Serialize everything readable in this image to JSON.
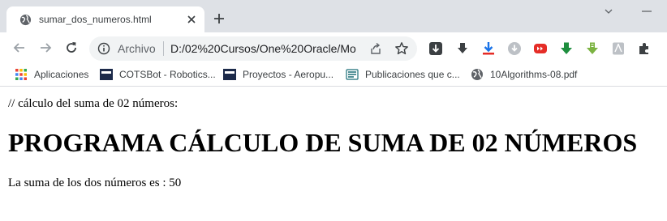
{
  "tab": {
    "title": "sumar_dos_numeros.html"
  },
  "omnibox": {
    "scheme_label": "Archivo",
    "url": "D:/02%20Cursos/One%20Oracle/Mo..."
  },
  "bookmarks": [
    {
      "label": "Aplicaciones",
      "icon": "apps-grid-icon"
    },
    {
      "label": "COTSBot - Robotics...",
      "icon": "qut-icon"
    },
    {
      "label": "Proyectos - Aeropu...",
      "icon": "qut-icon"
    },
    {
      "label": "Publicaciones que c...",
      "icon": "publications-icon"
    },
    {
      "label": "10Algorithms-08.pdf",
      "icon": "globe-icon"
    }
  ],
  "page": {
    "comment": "// cálculo del suma de 02 números:",
    "heading": "PROGRAMA CÁLCULO DE SUMA DE 02 NÚMEROS",
    "result": "La suma de los dos números es : 50"
  },
  "colors": {
    "tabstrip": "#dee1e6",
    "omnibox": "#f1f3f4",
    "download_blue": "#1a73e8",
    "youtube_red": "#e52d27",
    "green_arrow": "#1e8e3e",
    "lime_arrow": "#7cb342"
  }
}
